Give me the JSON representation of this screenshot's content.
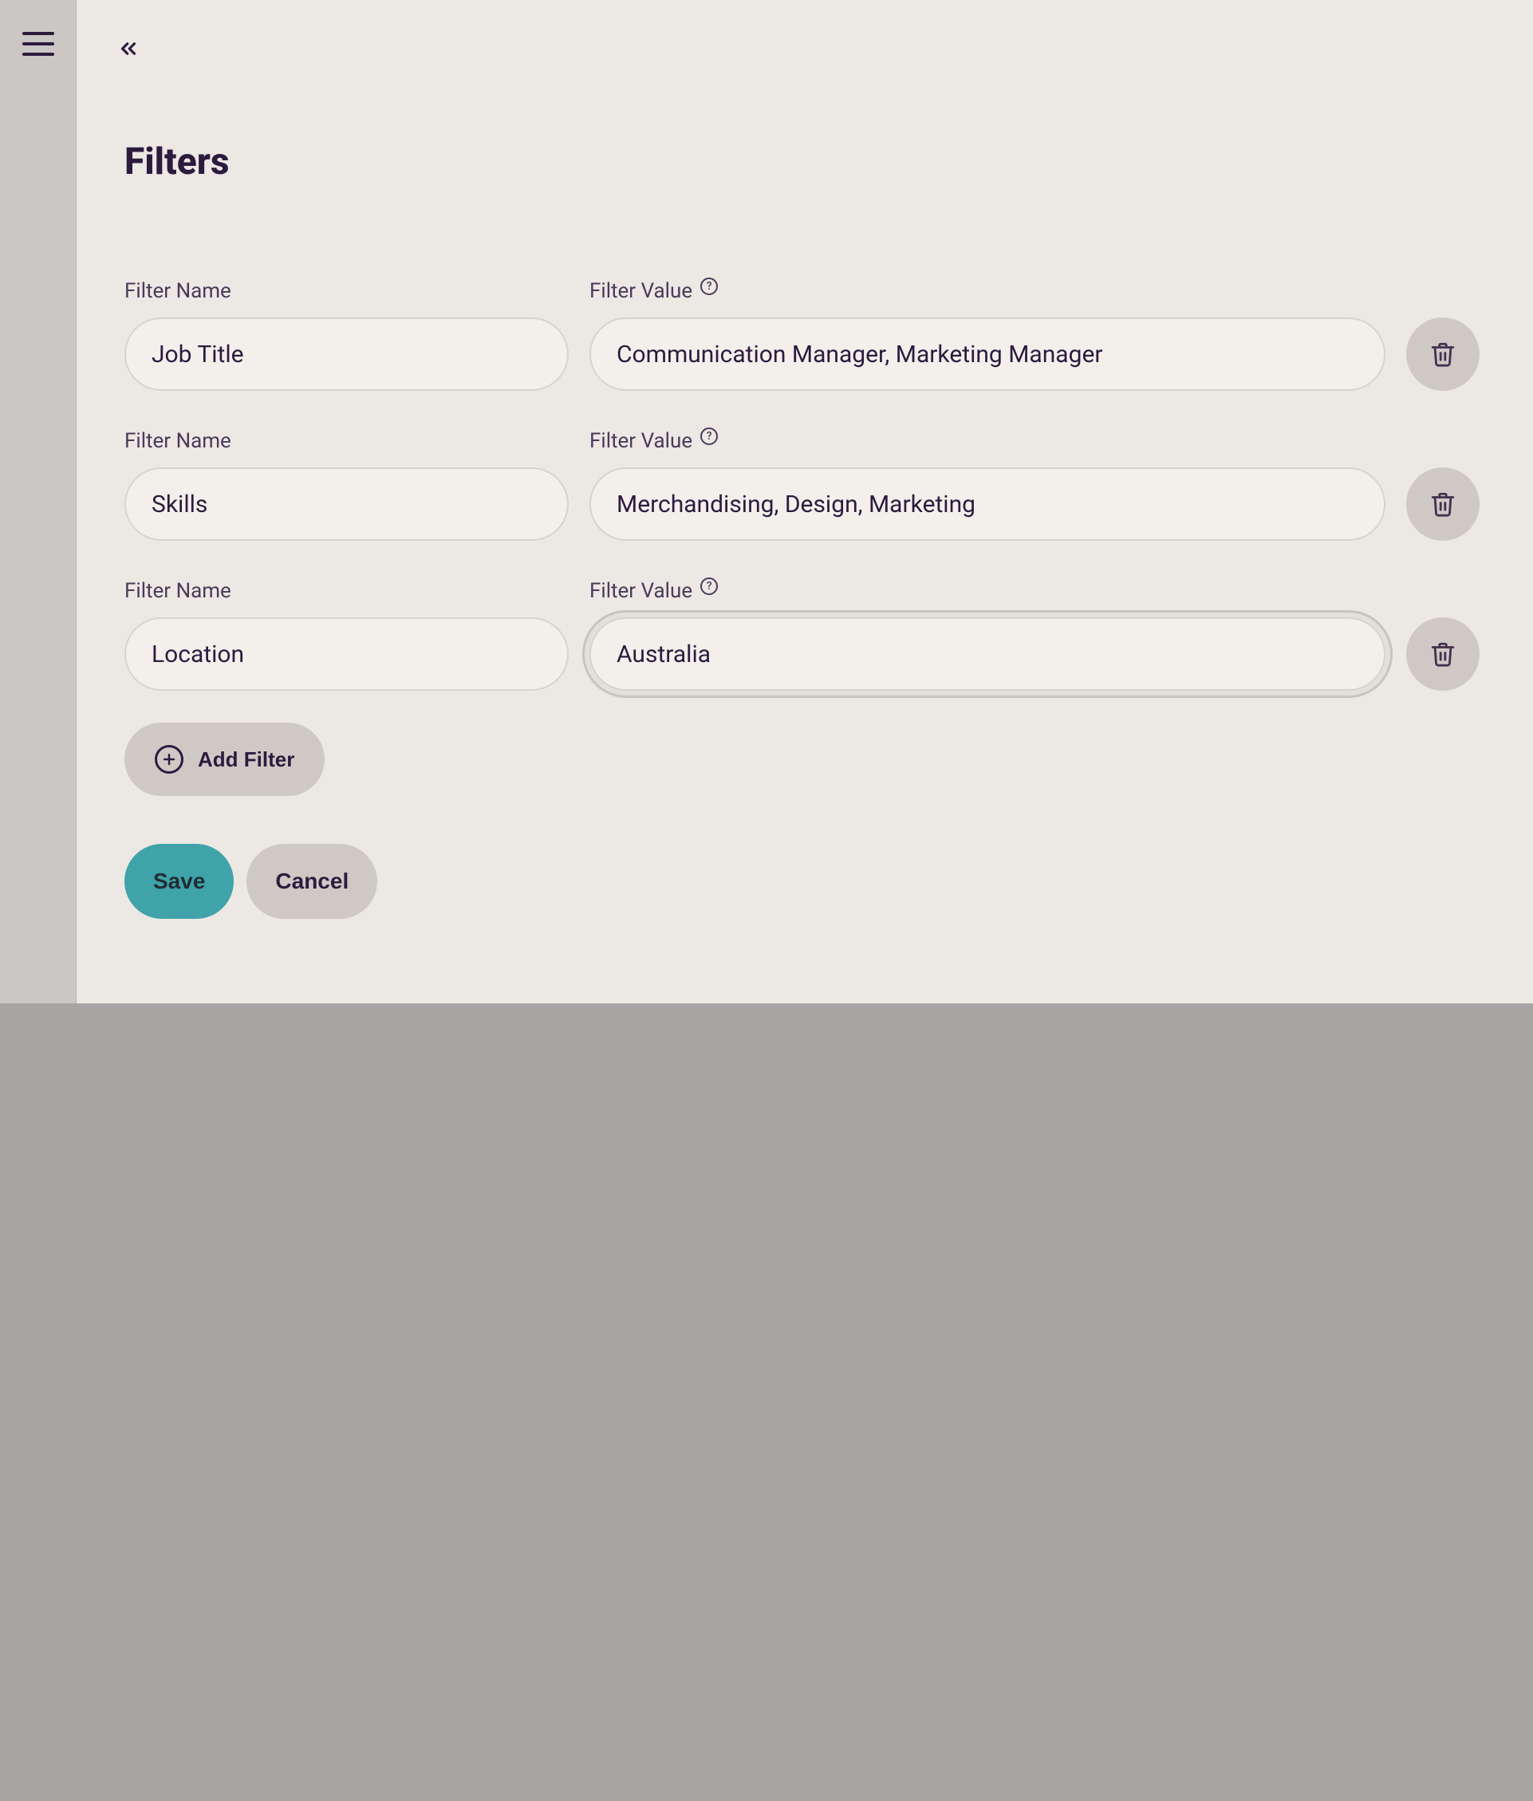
{
  "title": "Filters",
  "labels": {
    "filter_name": "Filter Name",
    "filter_value": "Filter Value"
  },
  "filters": [
    {
      "name": "Job Title",
      "value": "Communication Manager, Marketing Manager"
    },
    {
      "name": "Skills",
      "value": "Merchandising, Design, Marketing"
    },
    {
      "name": "Location",
      "value": "Australia"
    }
  ],
  "buttons": {
    "add_filter": "Add Filter",
    "save": "Save",
    "cancel": "Cancel"
  },
  "focused_filter_value_index": 2,
  "colors": {
    "accent": "#3fa3a9",
    "text": "#2d1b3e",
    "panel_bg": "#ece8e4",
    "pill_bg": "#cfc9c6",
    "input_bg": "#f3f0ec"
  }
}
